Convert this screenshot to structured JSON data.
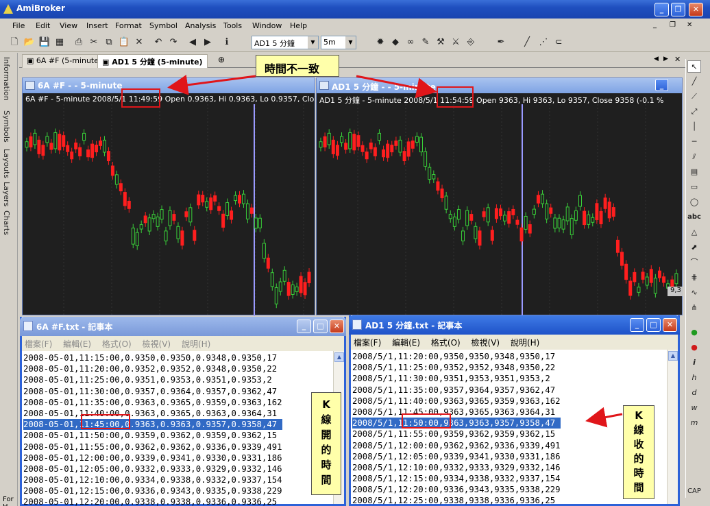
{
  "app": {
    "title": "AmiBroker"
  },
  "menu": [
    "File",
    "Edit",
    "View",
    "Insert",
    "Format",
    "Symbol",
    "Analysis",
    "Tools",
    "Window",
    "Help"
  ],
  "toolbar": {
    "symbol_value": "AD1 5 分鐘",
    "interval_value": "5m"
  },
  "doc_tabs": [
    "6A #F (5-minute)",
    "AD1 5 分鐘 (5-minute)"
  ],
  "side_tabs": [
    "Information",
    "Symbols",
    "Layouts",
    "Layers",
    "Charts"
  ],
  "drawbar_labels": {
    "text_tool": "abc"
  },
  "chart_left": {
    "caption": "6A #F -  - 5-minute",
    "info_prefix": "6A #F - 5-minute 2008/5/1",
    "info_time": "11:49:59",
    "info_suffix": "Open 0.9363, Hi 0.9363, Lo 0.9357, Close"
  },
  "chart_right": {
    "caption": "AD1 5 分鐘 -  - 5-minute",
    "info_prefix": "AD1 5 分鐘 - 5-minute 2008/5/1",
    "info_time": "11:54:59",
    "info_suffix": "Open 9363, Hi 9363, Lo 9357, Close 9358 (-0.1 %",
    "price_label": "9,3"
  },
  "notepad_left": {
    "caption": "6A #F.txt - 記事本",
    "menu": [
      "檔案(F)",
      "編輯(E)",
      "格式(O)",
      "檢視(V)",
      "說明(H)"
    ],
    "rows": [
      "2008-05-01,11:15:00,0.9350,0.9350,0.9348,0.9350,17",
      "2008-05-01,11:20:00,0.9352,0.9352,0.9348,0.9350,22",
      "2008-05-01,11:25:00,0.9351,0.9353,0.9351,0.9353,2",
      "2008-05-01,11:30:00,0.9357,0.9364,0.9357,0.9362,47",
      "2008-05-01,11:35:00,0.9363,0.9365,0.9359,0.9363,162",
      "2008-05-01,11:40:00,0.9363,0.9365,0.9363,0.9364,31",
      "2008-05-01,11:45:00,0.9363,0.9363,0.9357,0.9358,47",
      "2008-05-01,11:50:00,0.9359,0.9362,0.9359,0.9362,15",
      "2008-05-01,11:55:00,0.9362,0.9362,0.9336,0.9339,491",
      "2008-05-01,12:00:00,0.9339,0.9341,0.9330,0.9331,186",
      "2008-05-01,12:05:00,0.9332,0.9333,0.9329,0.9332,146",
      "2008-05-01,12:10:00,0.9334,0.9338,0.9332,0.9337,154",
      "2008-05-01,12:15:00,0.9336,0.9343,0.9335,0.9338,229",
      "2008-05-01,12:20:00,0.9338,0.9338,0.9336,0.9336,25"
    ],
    "selected_row": 6
  },
  "notepad_right": {
    "caption": "AD1 5 分鐘.txt - 記事本",
    "menu": [
      "檔案(F)",
      "編輯(E)",
      "格式(O)",
      "檢視(V)",
      "說明(H)"
    ],
    "rows": [
      "2008/5/1,11:20:00,9350,9350,9348,9350,17",
      "2008/5/1,11:25:00,9352,9352,9348,9350,22",
      "2008/5/1,11:30:00,9351,9353,9351,9353,2",
      "2008/5/1,11:35:00,9357,9364,9357,9362,47",
      "2008/5/1,11:40:00,9363,9365,9359,9363,162",
      "2008/5/1,11:45:00,9363,9365,9363,9364,31",
      "2008/5/1,11:50:00,9363,9363,9357,9358,47",
      "2008/5/1,11:55:00,9359,9362,9359,9362,15",
      "2008/5/1,12:00:00,9362,9362,9336,9339,491",
      "2008/5/1,12:05:00,9339,9341,9330,9331,186",
      "2008/5/1,12:10:00,9332,9333,9329,9332,146",
      "2008/5/1,12:15:00,9334,9338,9332,9337,154",
      "2008/5/1,12:20:00,9336,9343,9335,9338,229",
      "2008/5/1,12:25:00,9338,9338,9336,9336,25"
    ],
    "selected_row": 6
  },
  "annotations": {
    "top": "時間不一致",
    "left_chars": [
      "K",
      "線",
      "開",
      "的",
      "時",
      "間"
    ],
    "right_chars": [
      "K",
      "線",
      "收",
      "的",
      "時",
      "間"
    ]
  },
  "status_left": "For H",
  "status_right": "CAP",
  "colors": {
    "bull": "#39d039",
    "bear": "#ff1f1f",
    "cursor": "#9a9aff",
    "highlight": "#316ac5",
    "callout_bg": "#ffffaa"
  }
}
